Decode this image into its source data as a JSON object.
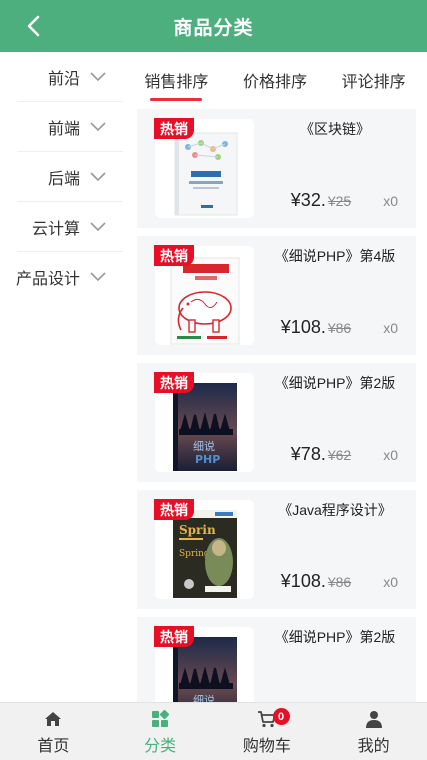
{
  "header": {
    "title": "商品分类",
    "back_icon": "chevron-left-icon"
  },
  "sidebar": {
    "items": [
      {
        "label": "前沿"
      },
      {
        "label": "前端"
      },
      {
        "label": "后端"
      },
      {
        "label": "云计算"
      },
      {
        "label": "产品设计"
      }
    ]
  },
  "sort_tabs": [
    {
      "label": "销售排序",
      "active": true
    },
    {
      "label": "价格排序",
      "active": false
    },
    {
      "label": "评论排序",
      "active": false
    }
  ],
  "products": [
    {
      "badge": "热销",
      "name": "《区块链》",
      "price": "¥32.",
      "original_price": "¥25",
      "qty": "x0",
      "cover": "blockchain-cover"
    },
    {
      "badge": "热销",
      "name": "《细说PHP》第4版",
      "price": "¥108.",
      "original_price": "¥86",
      "qty": "x0",
      "cover": "php-elephant-cover"
    },
    {
      "badge": "热销",
      "name": "《细说PHP》第2版",
      "price": "¥78.",
      "original_price": "¥62",
      "qty": "x0",
      "cover": "php-dark-cover"
    },
    {
      "badge": "热销",
      "name": "《Java程序设计》",
      "price": "¥108.",
      "original_price": "¥86",
      "qty": "x0",
      "cover": "spring-cover"
    },
    {
      "badge": "热销",
      "name": "《细说PHP》第2版",
      "price": "",
      "original_price": "",
      "qty": "",
      "cover": "php-dark-cover"
    }
  ],
  "tabbar": {
    "items": [
      {
        "label": "首页",
        "icon": "home-icon"
      },
      {
        "label": "分类",
        "icon": "category-icon",
        "active": true
      },
      {
        "label": "购物车",
        "icon": "cart-icon",
        "badge": "0"
      },
      {
        "label": "我的",
        "icon": "user-icon"
      }
    ]
  },
  "colors": {
    "brand": "#4caf7d",
    "accent": "#e8303c",
    "badge": "#e60f26"
  }
}
